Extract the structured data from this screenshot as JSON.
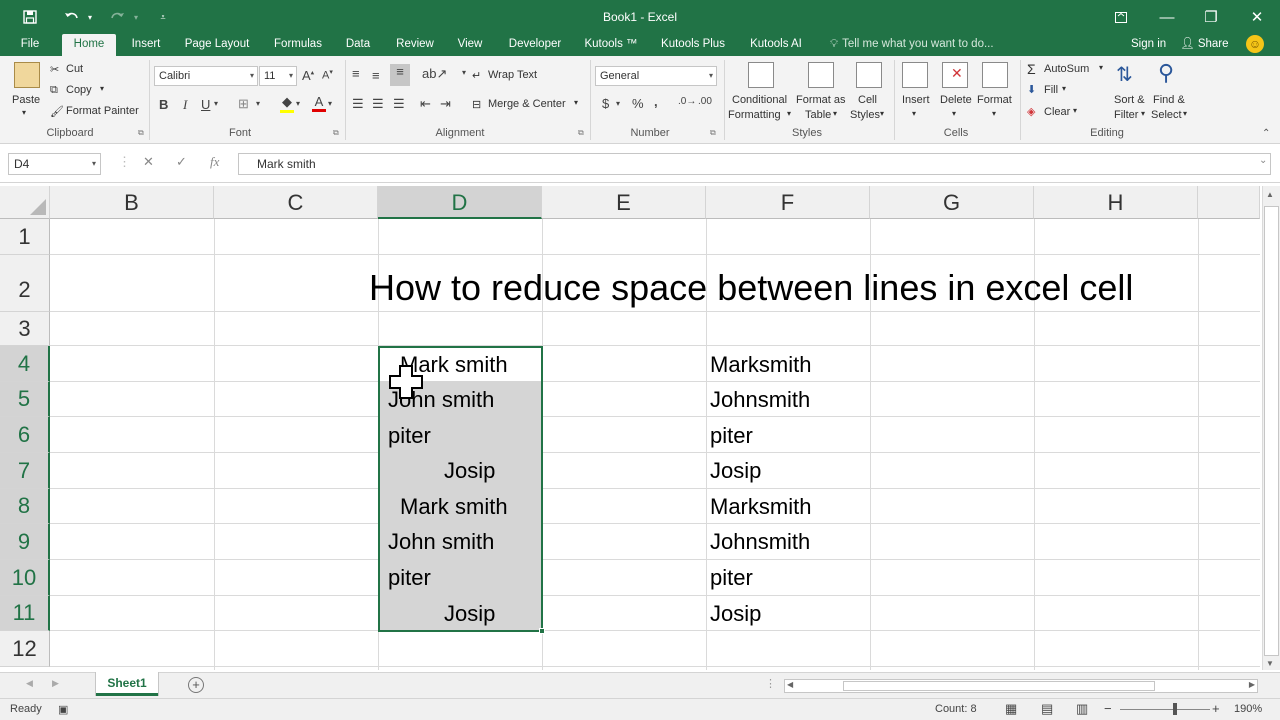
{
  "window": {
    "title": "Book1 - Excel",
    "undo_icon": "undo-icon",
    "redo_icon": "redo-icon",
    "save_icon": "save-icon",
    "customize_icon": "customize-quick-access-icon",
    "ribbon_display_icon": "ribbon-display-options-icon",
    "minimize": "—",
    "restore": "❐",
    "close": "✕"
  },
  "tabs": {
    "items": [
      "File",
      "Home",
      "Insert",
      "Page Layout",
      "Formulas",
      "Data",
      "Review",
      "View",
      "Developer",
      "Kutools ™",
      "Kutools Plus",
      "Kutools AI"
    ],
    "active": "Home",
    "tell_me": "Tell me what you want to do...",
    "sign_in": "Sign in",
    "share": "Share"
  },
  "ribbon": {
    "clipboard": {
      "paste": "Paste",
      "cut": "Cut",
      "copy": "Copy",
      "format_painter": "Format Painter",
      "label": "Clipboard"
    },
    "font": {
      "font_name": "Calibri",
      "font_size": "11",
      "bold": "B",
      "italic": "I",
      "underline": "U",
      "label": "Font"
    },
    "alignment": {
      "wrap_text": "Wrap Text",
      "merge_center": "Merge & Center",
      "label": "Alignment"
    },
    "number": {
      "format": "General",
      "currency": "$",
      "percent": "%",
      "comma": ",",
      "label": "Number"
    },
    "styles": {
      "conditional_formatting_1": "Conditional",
      "conditional_formatting_2": "Formatting",
      "format_as_table_1": "Format as",
      "format_as_table_2": "Table",
      "cell_styles_1": "Cell",
      "cell_styles_2": "Styles",
      "label": "Styles"
    },
    "cells": {
      "insert": "Insert",
      "delete": "Delete",
      "format": "Format",
      "label": "Cells"
    },
    "editing": {
      "autosum": "AutoSum",
      "fill": "Fill",
      "clear": "Clear",
      "sort_filter_1": "Sort &",
      "sort_filter_2": "Filter",
      "find_select_1": "Find &",
      "find_select_2": "Select",
      "label": "Editing"
    }
  },
  "formula_bar": {
    "name_box": "D4",
    "cancel": "✕",
    "enter": "✓",
    "fx": "fx",
    "content": "Mark smith"
  },
  "sheet": {
    "columns": [
      "B",
      "C",
      "D",
      "E",
      "F",
      "G",
      "H"
    ],
    "selected_column": "D",
    "rows": [
      "1",
      "2",
      "3",
      "4",
      "5",
      "6",
      "7",
      "8",
      "9",
      "10",
      "11",
      "12"
    ],
    "selected_rows": [
      "4",
      "5",
      "6",
      "7",
      "8",
      "9",
      "10",
      "11"
    ],
    "title": "How to reduce space between lines in excel cell",
    "column_d": [
      "Mark smith",
      "John smith",
      "piter",
      "Josip",
      "Mark smith",
      "John smith",
      "piter",
      "Josip"
    ],
    "column_f": [
      "Marksmith",
      "Johnsmith",
      "piter",
      "Josip",
      "Marksmith",
      "Johnsmith",
      "piter",
      "Josip"
    ]
  },
  "sheet_tabs": {
    "active": "Sheet1",
    "add_icon": "add-sheet-icon"
  },
  "status_bar": {
    "ready": "Ready",
    "count": "Count: 8",
    "zoom": "190%",
    "zoom_out": "−",
    "zoom_in": "+"
  },
  "colors": {
    "accent": "#217346",
    "selection_fill": "#d5d5d5"
  }
}
